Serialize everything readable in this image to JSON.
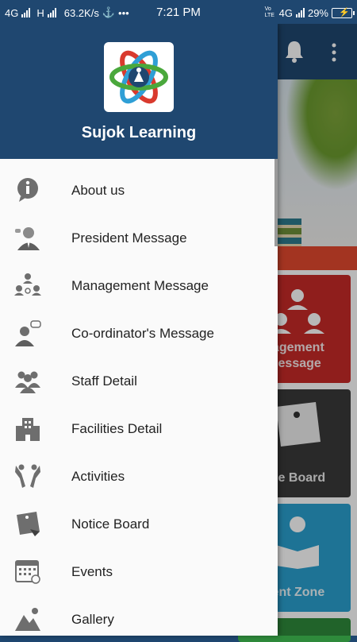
{
  "status_bar": {
    "network1": "4G",
    "network2": "H",
    "speed": "63.2K/s",
    "overflow": "•••",
    "time": "7:21 PM",
    "volte": "Vo LTE",
    "network3": "4G",
    "battery": "29%"
  },
  "drawer": {
    "app_title": "Sujok Learning",
    "items": [
      {
        "label": "About us",
        "icon": "info-icon"
      },
      {
        "label": "President Message",
        "icon": "president-icon"
      },
      {
        "label": "Management Message",
        "icon": "management-icon"
      },
      {
        "label": "Co-ordinator's Message",
        "icon": "coordinator-icon"
      },
      {
        "label": "Staff Detail",
        "icon": "staff-icon"
      },
      {
        "label": "Facilities Detail",
        "icon": "building-icon"
      },
      {
        "label": "Activities",
        "icon": "activities-icon"
      },
      {
        "label": "Notice Board",
        "icon": "notice-board-icon"
      },
      {
        "label": "Events",
        "icon": "calendar-icon"
      },
      {
        "label": "Gallery",
        "icon": "gallery-icon"
      }
    ]
  },
  "background": {
    "tiles": [
      {
        "label": "Management Message",
        "visible_text": "nagement\nMessage",
        "color": "#c62a28"
      },
      {
        "label": "Notice Board",
        "visible_text": "tice Board",
        "color": "#3a3a3a"
      },
      {
        "label": "Student Zone",
        "visible_text": "dent Zone",
        "color": "#2aa0cf"
      }
    ]
  },
  "colors": {
    "primary": "#1f4770",
    "drawer_bg": "#fafafa",
    "icon_gray": "#6e6e6e"
  }
}
